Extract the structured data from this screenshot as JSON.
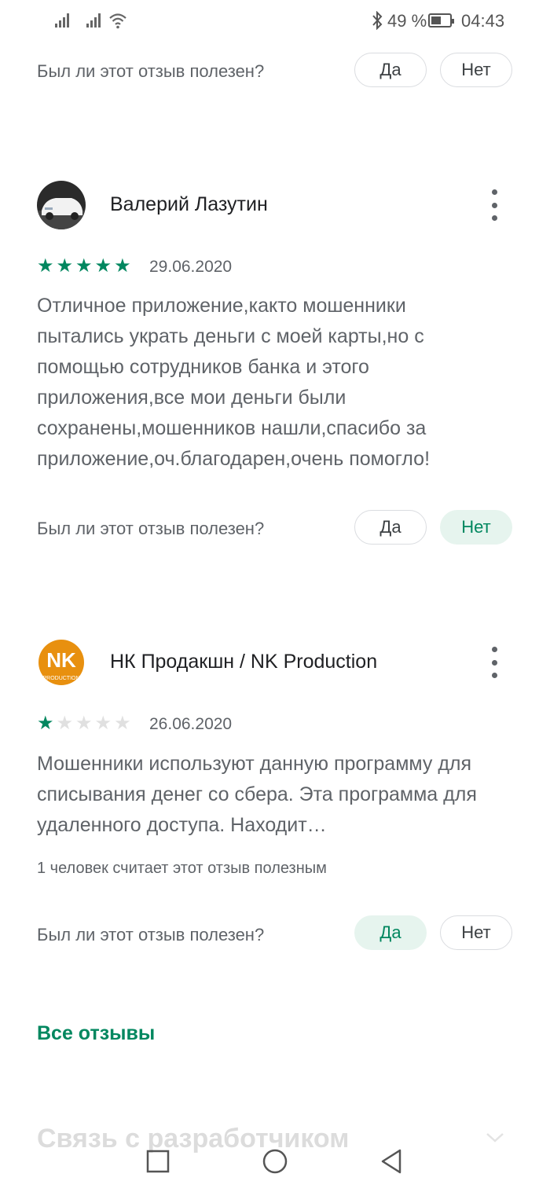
{
  "status": {
    "battery_text": "49 %",
    "time": "04:43"
  },
  "helpful_question": "Был ли этот отзыв полезен?",
  "yes_label": "Да",
  "no_label": "Нет",
  "reviews": [
    {
      "author": "Валерий Лазутин",
      "rating": 5,
      "date": "29.06.2020",
      "text": "Отличное приложение,както мошенники пытались украть деньги с моей карты,но с помощью сотрудников банка и этого приложения,все мои деньги были сохранены,мошенников нашли,спасибо за приложение,оч.благодарен,очень помогло!",
      "vote": "no"
    },
    {
      "author": "НК Продакшн / NK Production",
      "avatar_text": "NK",
      "avatar_sub": "PRODUCTION",
      "rating": 1,
      "date": "26.06.2020",
      "text": "Мошенники используют данную программу для списывания денег со сбера. Эта программа для удаленного доступа. Находит…",
      "helpful_count": "1 человек считает этот отзыв полезным",
      "vote": "yes"
    }
  ],
  "all_reviews": "Все отзывы",
  "contact_developer": "Связь с разработчиком",
  "icons": {
    "signal": "signal-bars-icon",
    "wifi": "wifi-icon",
    "bluetooth": "bluetooth-icon",
    "battery": "battery-icon",
    "kebab": "more-vert-icon",
    "star": "star-icon",
    "chevron": "chevron-down-icon",
    "nav_recents": "square-icon",
    "nav_home": "circle-icon",
    "nav_back": "triangle-back-icon"
  },
  "colors": {
    "accent": "#01875f",
    "active_pill_bg": "#e6f4ee",
    "text_secondary": "#5f6368"
  }
}
